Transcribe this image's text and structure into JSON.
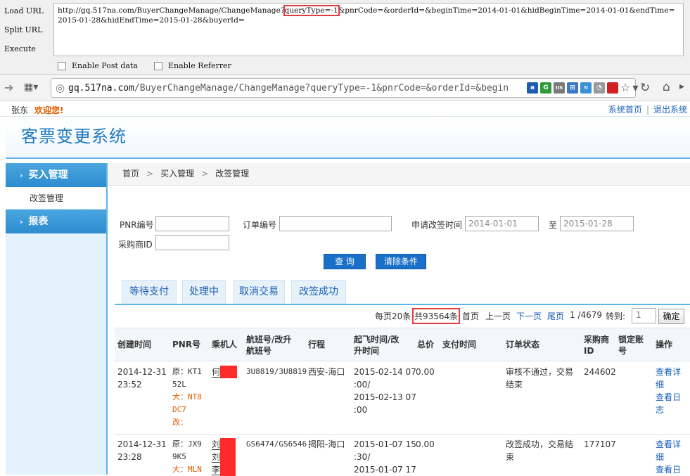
{
  "hackbar": {
    "actions": [
      "Load URL",
      "Split URL",
      "Execute"
    ],
    "url_part1": "http://gq.517na.com/BuyerChangeManage/ChangeManage?",
    "url_highlight": "queryType=-1",
    "url_part2": "&pnrCode=&orderId=&beginTime=2014-01-01&hidBeginTime=2014-01-01&endTime=2015-01-28&hidEndTime=2015-01-28&buyerId=",
    "enable_post": "Enable Post data",
    "enable_referrer": "Enable Referrer"
  },
  "browser": {
    "address_host": "gq.517na.com",
    "address_path": "/BuyerChangeManage/ChangeManage?queryType=-1&pnrCode=&orderId=&begin"
  },
  "topbar": {
    "user": "张东",
    "welcome": "欢迎您!",
    "home_link": "系统首页",
    "logout_link": "退出系统"
  },
  "header": {
    "title": "客票变更系统"
  },
  "sidebar": {
    "menu1": "买入管理",
    "submenu1": "改签管理",
    "menu2": "报表"
  },
  "breadcrumb": {
    "home": "首页",
    "level1": "买入管理",
    "level2": "改签管理"
  },
  "form": {
    "pnr_label": "PNR编号",
    "order_label": "订单编号",
    "apply_time_label": "申请改签时间",
    "begin_time": "2014-01-01",
    "to_label": "至",
    "end_time": "2015-01-28",
    "buyer_label": "采购商ID",
    "search_btn": "查 询",
    "clear_btn": "清除条件"
  },
  "tabs": [
    "等待支付",
    "处理中",
    "取消交易",
    "改签成功"
  ],
  "pager": {
    "per_page": "每页20条",
    "total": "共93564条",
    "first": "首页",
    "prev": "上一页",
    "next": "下一页",
    "last": "尾页",
    "page_info": "1 /4679",
    "goto": "转到:",
    "page_value": "1",
    "confirm": "确定"
  },
  "table": {
    "headers": {
      "create_time": "创建时间",
      "pnr": "PNR号",
      "passenger": "乘机人",
      "flight_l1": "航班号/改升",
      "flight_l2": "航班号",
      "route": "行程",
      "dep_l1": "起飞时间/改",
      "dep_l2": "升时间",
      "total": "总价",
      "pay_time": "支付时间",
      "status": "订单状态",
      "buyer_l1": "采购商",
      "buyer_l2": "ID",
      "lock_l1": "锁定账",
      "lock_l2": "号",
      "action": "操作"
    },
    "rows": [
      {
        "create_date": "2014-12-31",
        "create_time": "23:52",
        "pnr_l1": "原：KT1",
        "pnr_l2": "52L",
        "pnr_l3": "大：NT8",
        "pnr_l4": "DC7",
        "pnr_l5": "改：",
        "passenger": "何",
        "flight": "3U8819/3U8819",
        "route": "西安-海口",
        "dep_l1": "2015-02-14 07",
        "dep_l2": ":00/",
        "dep_l3": "2015-02-13 07",
        "dep_l4": ":00",
        "total": "0.00",
        "status_l1": "审核不通过，交易",
        "status_l2": "结束",
        "buyer_id": "244602",
        "view_l1": "查看详",
        "view_l2": "细",
        "log_l1": "查看日",
        "log_l2": "志"
      },
      {
        "create_date": "2014-12-31",
        "create_time": "23:28",
        "pnr_l1": "原：JX9",
        "pnr_l2": "9K5",
        "pnr_l3": "大：MLN",
        "passenger_1": "刘",
        "passenger_2": "刘",
        "passenger_3": "李",
        "flight": "GS6474/GS6546",
        "route": "揭阳-海口",
        "dep_l1": "2015-01-07 15",
        "dep_l2": ":30/",
        "dep_l3": "2015-01-07 17",
        "total": "0.00",
        "status_l1": "改签成功，交易结",
        "status_l2": "束",
        "buyer_id": "177107",
        "view_l1": "查看详",
        "view_l2": "细",
        "log_l1": "查看日"
      }
    ]
  },
  "colors": {
    "accent": "#5db4e8",
    "link": "#1a5fb4",
    "highlight": "#e05a00",
    "redact": "#ff2a2a"
  }
}
